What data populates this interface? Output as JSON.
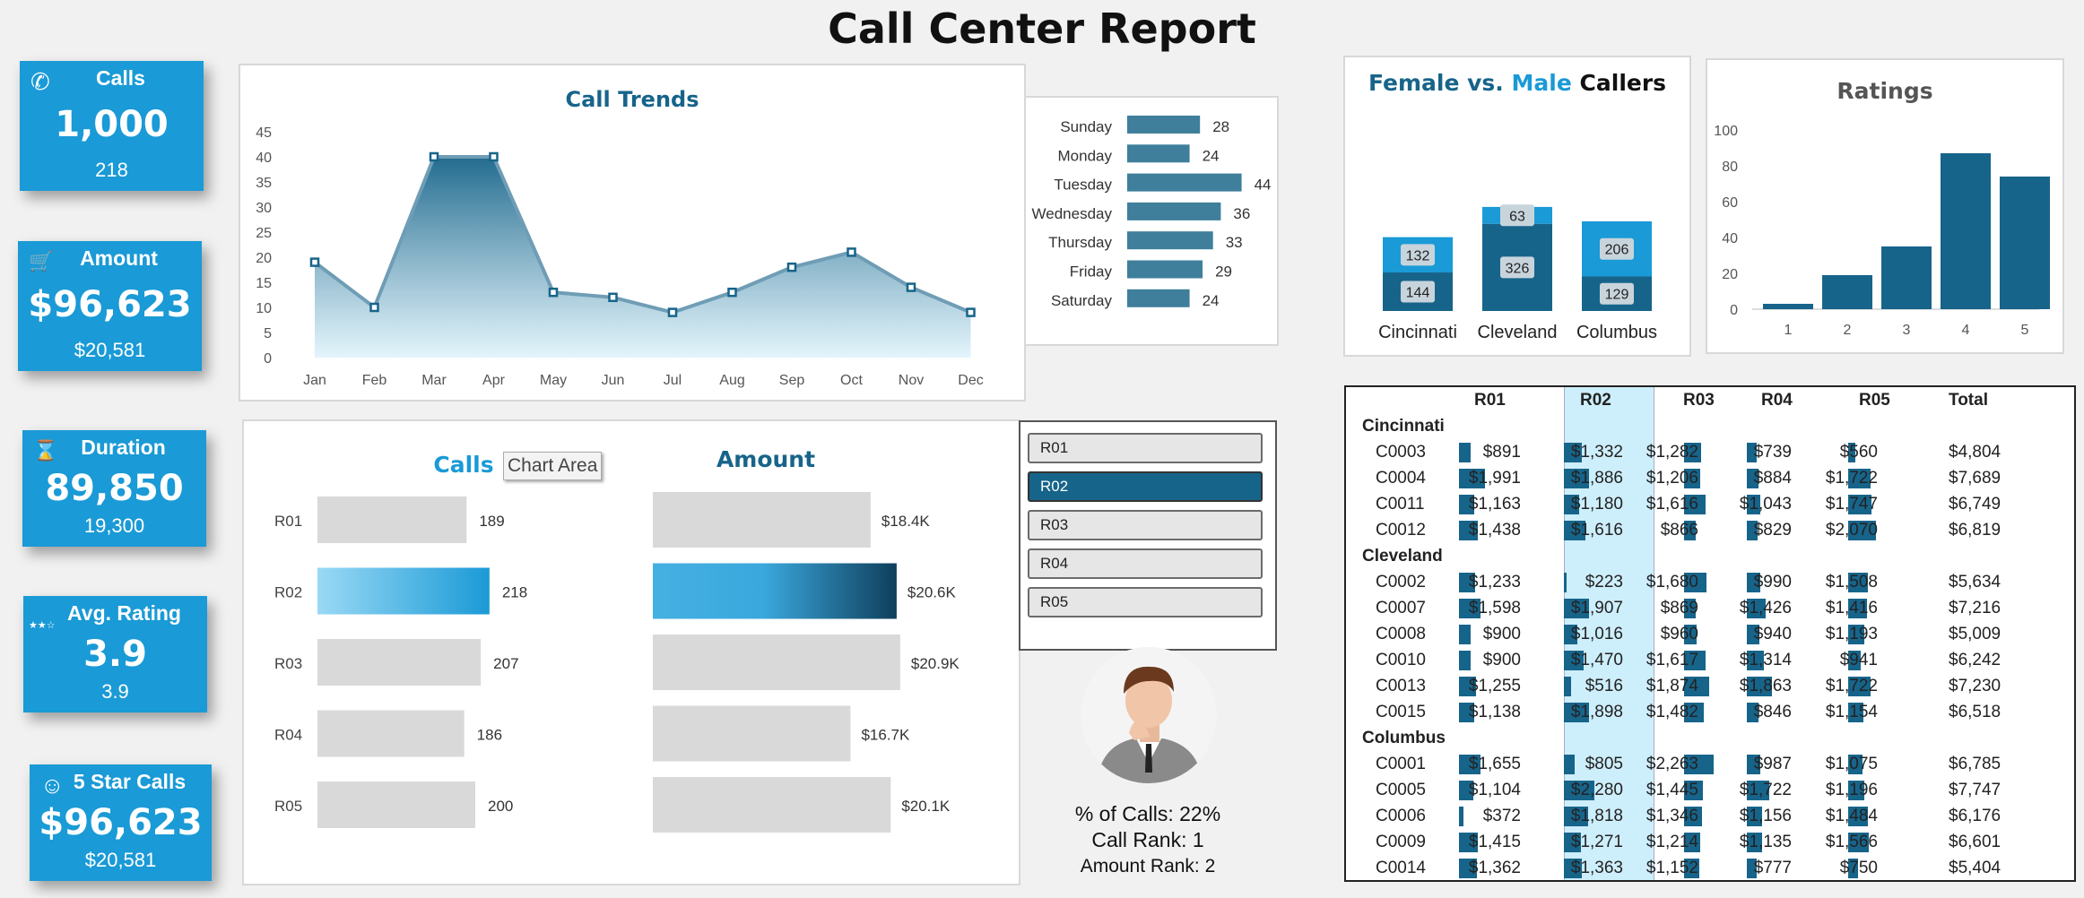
{
  "title": "Call Center Report",
  "colors": {
    "accent": "#1a9ad6",
    "dark": "#17648a",
    "light": "#cdeefb",
    "grey": "#d9d9d9"
  },
  "kpis": [
    {
      "icon": "phone-icon",
      "glyph": "✆",
      "label": "Calls",
      "value": "1,000",
      "sub": "218"
    },
    {
      "icon": "cart-icon",
      "glyph": "🛒",
      "label": "Amount",
      "value": "$96,623",
      "sub": "$20,581"
    },
    {
      "icon": "hourglass-icon",
      "glyph": "⌛",
      "label": "Duration",
      "value": "89,850",
      "sub": "19,300"
    },
    {
      "icon": "stars-icon",
      "glyph": "★★☆",
      "label": "Avg. Rating",
      "value": "3.9",
      "sub": "3.9"
    },
    {
      "icon": "smiley-icon",
      "glyph": "☺",
      "label": "5 Star Calls",
      "value": "$96,623",
      "sub": "$20,581"
    }
  ],
  "trends": {
    "title": "Call Trends",
    "months": [
      "Jan",
      "Feb",
      "Mar",
      "Apr",
      "May",
      "Jun",
      "Jul",
      "Aug",
      "Sep",
      "Oct",
      "Nov",
      "Dec"
    ],
    "values": [
      19,
      10,
      40,
      40,
      13,
      12,
      9,
      13,
      18,
      21,
      14,
      9
    ],
    "yticks": [
      0,
      5,
      10,
      15,
      20,
      25,
      30,
      35,
      40,
      45
    ]
  },
  "weekdays": {
    "days": [
      "Sunday",
      "Monday",
      "Tuesday",
      "Wednesday",
      "Thursday",
      "Friday",
      "Saturday"
    ],
    "values": [
      28,
      24,
      44,
      36,
      33,
      29,
      24
    ]
  },
  "rep_compare": {
    "calls_title": "Calls",
    "amount_title": "Amount",
    "tooltip": "Chart Area",
    "reps": [
      "R01",
      "R02",
      "R03",
      "R04",
      "R05"
    ],
    "calls": [
      189,
      218,
      207,
      186,
      200
    ],
    "amount_labels": [
      "$18.4K",
      "$20.6K",
      "$20.9K",
      "$16.7K",
      "$20.1K"
    ],
    "amounts": [
      18.4,
      20.6,
      20.9,
      16.7,
      20.1
    ],
    "selected": 1
  },
  "slicer": {
    "items": [
      "R01",
      "R02",
      "R03",
      "R04",
      "R05"
    ],
    "selected": 1
  },
  "rep_stats": {
    "pct": "% of Calls: 22%",
    "call_rank": "Call Rank: 1",
    "amount_rank": "Amount Rank: 2"
  },
  "gender": {
    "title_female": "Female",
    "title_vs": "vs.",
    "title_male": "Male",
    "title_rest": "Callers",
    "cities": [
      "Cincinnati",
      "Cleveland",
      "Columbus"
    ],
    "female": [
      144,
      326,
      129
    ],
    "male": [
      132,
      63,
      206
    ]
  },
  "ratings": {
    "title": "Ratings",
    "categories": [
      "1",
      "2",
      "3",
      "4",
      "5"
    ],
    "values": [
      3,
      19,
      35,
      87,
      74
    ],
    "yticks": [
      0,
      20,
      40,
      60,
      80,
      100
    ]
  },
  "table": {
    "headers": [
      "R01",
      "R02",
      "R03",
      "R04",
      "R05",
      "Total"
    ],
    "groups": [
      {
        "city": "Cincinnati",
        "rows": [
          {
            "id": "C0003",
            "vals": [
              "$891",
              "$1,332",
              "$1,282",
              "$739",
              "$560"
            ],
            "nums": [
              891,
              1332,
              1282,
              739,
              560
            ],
            "total": "$4,804"
          },
          {
            "id": "C0004",
            "vals": [
              "$1,991",
              "$1,886",
              "$1,206",
              "$884",
              "$1,722"
            ],
            "nums": [
              1991,
              1886,
              1206,
              884,
              1722
            ],
            "total": "$7,689"
          },
          {
            "id": "C0011",
            "vals": [
              "$1,163",
              "$1,180",
              "$1,616",
              "$1,043",
              "$1,747"
            ],
            "nums": [
              1163,
              1180,
              1616,
              1043,
              1747
            ],
            "total": "$6,749"
          },
          {
            "id": "C0012",
            "vals": [
              "$1,438",
              "$1,616",
              "$866",
              "$829",
              "$2,070"
            ],
            "nums": [
              1438,
              1616,
              866,
              829,
              2070
            ],
            "total": "$6,819"
          }
        ]
      },
      {
        "city": "Cleveland",
        "rows": [
          {
            "id": "C0002",
            "vals": [
              "$1,233",
              "$223",
              "$1,680",
              "$990",
              "$1,508"
            ],
            "nums": [
              1233,
              223,
              1680,
              990,
              1508
            ],
            "total": "$5,634"
          },
          {
            "id": "C0007",
            "vals": [
              "$1,598",
              "$1,907",
              "$869",
              "$1,426",
              "$1,416"
            ],
            "nums": [
              1598,
              1907,
              869,
              1426,
              1416
            ],
            "total": "$7,216"
          },
          {
            "id": "C0008",
            "vals": [
              "$900",
              "$1,016",
              "$960",
              "$940",
              "$1,193"
            ],
            "nums": [
              900,
              1016,
              960,
              940,
              1193
            ],
            "total": "$5,009"
          },
          {
            "id": "C0010",
            "vals": [
              "$900",
              "$1,470",
              "$1,617",
              "$1,314",
              "$941"
            ],
            "nums": [
              900,
              1470,
              1617,
              1314,
              941
            ],
            "total": "$6,242"
          },
          {
            "id": "C0013",
            "vals": [
              "$1,255",
              "$516",
              "$1,874",
              "$1,863",
              "$1,722"
            ],
            "nums": [
              1255,
              516,
              1874,
              1863,
              1722
            ],
            "total": "$7,230"
          },
          {
            "id": "C0015",
            "vals": [
              "$1,138",
              "$1,898",
              "$1,482",
              "$846",
              "$1,154"
            ],
            "nums": [
              1138,
              1898,
              1482,
              846,
              1154
            ],
            "total": "$6,518"
          }
        ]
      },
      {
        "city": "Columbus",
        "rows": [
          {
            "id": "C0001",
            "vals": [
              "$1,655",
              "$805",
              "$2,263",
              "$987",
              "$1,075"
            ],
            "nums": [
              1655,
              805,
              2263,
              987,
              1075
            ],
            "total": "$6,785"
          },
          {
            "id": "C0005",
            "vals": [
              "$1,104",
              "$2,280",
              "$1,445",
              "$1,722",
              "$1,196"
            ],
            "nums": [
              1104,
              2280,
              1445,
              1722,
              1196
            ],
            "total": "$7,747"
          },
          {
            "id": "C0006",
            "vals": [
              "$372",
              "$1,818",
              "$1,346",
              "$1,156",
              "$1,484"
            ],
            "nums": [
              372,
              1818,
              1346,
              1156,
              1484
            ],
            "total": "$6,176"
          },
          {
            "id": "C0009",
            "vals": [
              "$1,415",
              "$1,271",
              "$1,214",
              "$1,135",
              "$1,566"
            ],
            "nums": [
              1415,
              1271,
              1214,
              1135,
              1566
            ],
            "total": "$6,601"
          },
          {
            "id": "C0014",
            "vals": [
              "$1,362",
              "$1,363",
              "$1,152",
              "$777",
              "$750"
            ],
            "nums": [
              1362,
              1363,
              1152,
              777,
              750
            ],
            "total": "$5,404"
          }
        ]
      }
    ]
  }
}
